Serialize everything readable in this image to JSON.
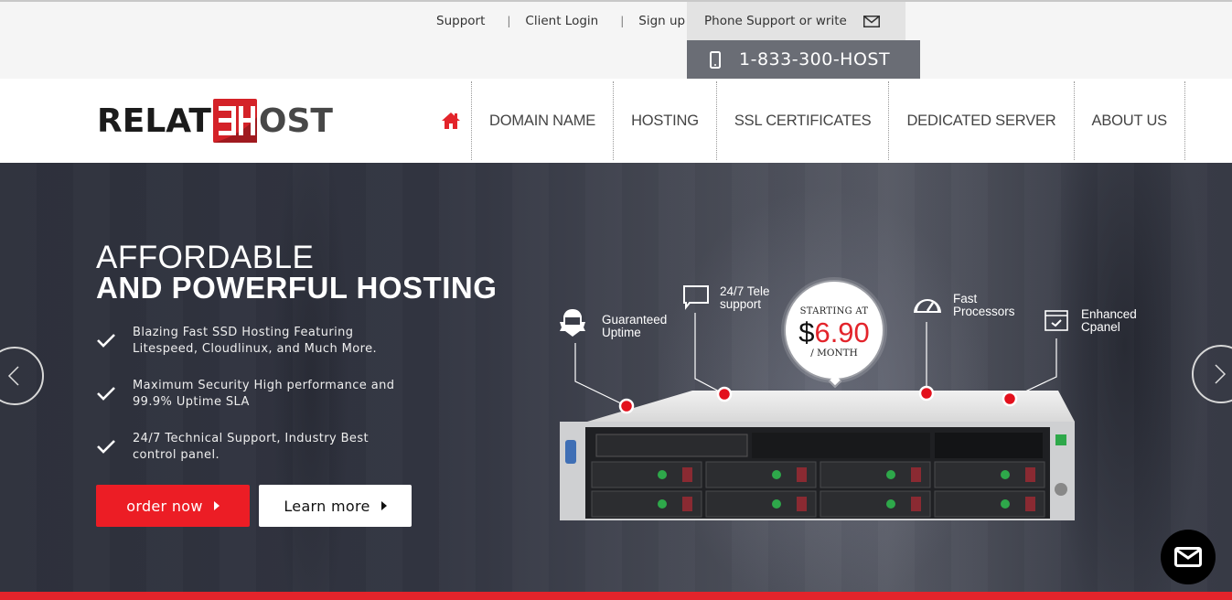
{
  "topbar": {
    "links": [
      {
        "label": "Support"
      },
      {
        "label": "Client Login"
      },
      {
        "label": "Sign up"
      }
    ],
    "separator": "|",
    "phone_support_label": "Phone Support or write",
    "phone_number": "1-833-300-HOST",
    "icons": {
      "write": "envelope-icon",
      "phone": "mobile-phone-icon"
    }
  },
  "logo": {
    "text_left": "RELAT",
    "text_right": "OST",
    "mark": "EH"
  },
  "nav": {
    "home_icon": "home-icon",
    "items": [
      {
        "label": "DOMAIN NAME"
      },
      {
        "label": "HOSTING"
      },
      {
        "label": "SSL CERTIFICATES"
      },
      {
        "label": "DEDICATED SERVER"
      },
      {
        "label": "ABOUT US"
      }
    ]
  },
  "hero": {
    "title_line1": "AFFORDABLE",
    "title_line2": "AND POWERFUL HOSTING",
    "features": [
      {
        "line1": "Blazing Fast SSD Hosting Featuring",
        "line2": "Litespeed, Cloudlinux, and Much More."
      },
      {
        "line1": "Maximum Security High performance and",
        "line2": "99.9% Uptime SLA"
      },
      {
        "line1": "24/7 Technical Support, Industry Best",
        "line2": "control panel."
      }
    ],
    "order_button": "order now",
    "learn_button": "Learn more",
    "callouts": [
      {
        "line1": "Guaranteed",
        "line2": "Uptime",
        "icon": "shield-badge-icon"
      },
      {
        "line1": "24/7 Tele",
        "line2": "support",
        "icon": "chat-bubble-icon"
      },
      {
        "line1": "Fast",
        "line2": "Processors",
        "icon": "speedometer-icon"
      },
      {
        "line1": "Enhanced",
        "line2": "Cpanel",
        "icon": "browser-check-icon"
      }
    ],
    "price": {
      "prefix": "STARTING AT",
      "currency": "$",
      "amount": "6.90",
      "suffix": "/ MONTH"
    },
    "colors": {
      "accent": "#ec1d25",
      "hero_bg": "#323541",
      "price_red": "#e3242b"
    }
  },
  "slider": {
    "prev_icon": "chevron-left-icon",
    "next_icon": "chevron-right-icon"
  },
  "chat_button": {
    "icon": "envelope-icon"
  }
}
